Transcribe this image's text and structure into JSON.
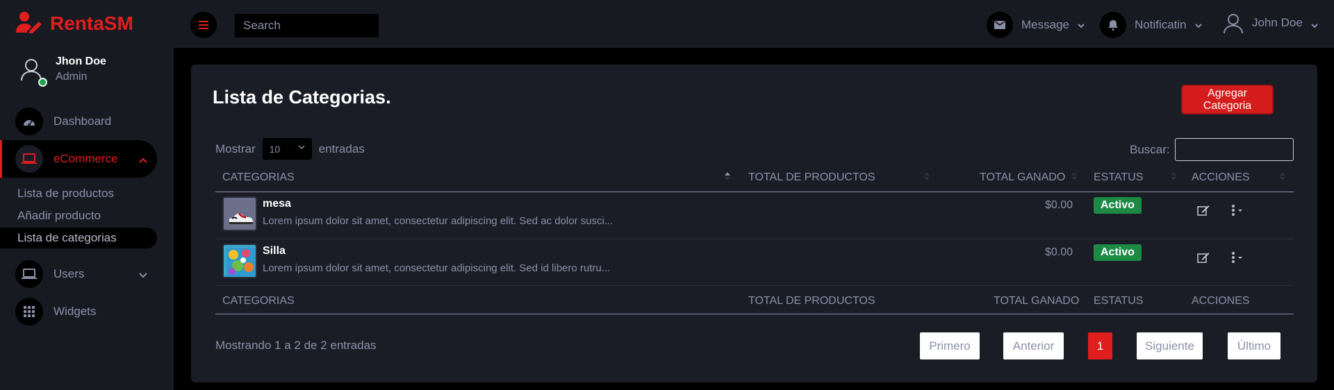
{
  "brand": {
    "name": "RentaSM"
  },
  "user": {
    "name": "Jhon Doe",
    "role": "Admin"
  },
  "sidebar": {
    "items": [
      {
        "label": "Dashboard",
        "icon": "dashboard-icon"
      },
      {
        "label": "eCommerce",
        "icon": "laptop-icon",
        "active": true
      },
      {
        "label": "Users",
        "icon": "laptop-icon"
      },
      {
        "label": "Widgets",
        "icon": "grid-icon"
      }
    ],
    "ecommerce_sub": [
      "Lista de productos",
      "Añadir producto",
      "Lista de categorias"
    ]
  },
  "topbar": {
    "search_placeholder": "Search",
    "message_label": "Message",
    "notification_label": "Notificatin",
    "account_label": "John Doe"
  },
  "page": {
    "title": "Lista de Categorias.",
    "add_button": "Agregar Categoria",
    "show_label": "Mostrar",
    "page_size": "10",
    "entries_label": "entradas",
    "search_label": "Buscar:",
    "info": "Mostrando 1 a 2 de 2 entradas"
  },
  "table": {
    "columns": [
      "CATEGORIAS",
      "TOTAL DE PRODUCTOS",
      "TOTAL GANADO",
      "ESTATUS",
      "ACCIONES"
    ],
    "rows": [
      {
        "name": "mesa",
        "description": "Lorem ipsum dolor sit amet, consectetur adipiscing elit. Sed ac dolor susci...",
        "earned": "$0.00",
        "status": "Activo"
      },
      {
        "name": "Silla",
        "description": "Lorem ipsum dolor sit amet, consectetur adipiscing elit. Sed id libero rutru...",
        "earned": "$0.00",
        "status": "Activo"
      }
    ]
  },
  "pagination": {
    "first": "Primero",
    "prev": "Anterior",
    "current": "1",
    "next": "Siguiente",
    "last": "Último"
  },
  "colors": {
    "accent": "#e01e1e",
    "panel": "#1b1d26",
    "sidebar": "#181a22",
    "success": "#1c8a45"
  }
}
